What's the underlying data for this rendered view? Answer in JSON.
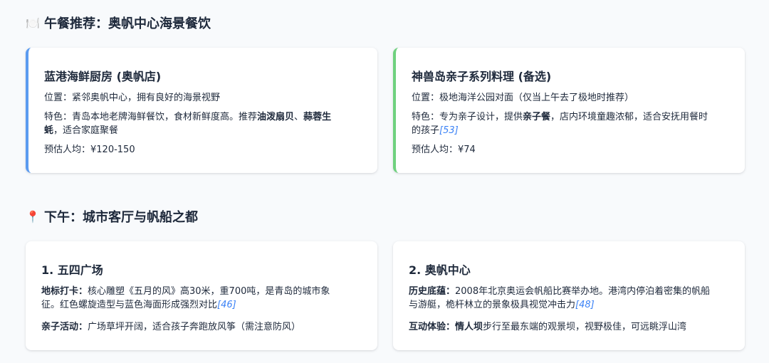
{
  "lunch": {
    "icon": "🍽️",
    "title": "午餐推荐：奥帆中心海景餐饮",
    "cards": [
      {
        "name": "蓝港海鲜厨房 (奥帆店)",
        "loc_label": "位置：",
        "loc": "紧邻奥帆中心，拥有良好的海景视野",
        "feat_label": "特色：",
        "feat_a": "青岛本地老牌海鲜餐饮，食材新鲜度高。推荐",
        "feat_b1": "油泼扇贝",
        "feat_sep": "、",
        "feat_b2": "蒜蓉生",
        "feat_b3": "蚝",
        "feat_c": "，适合家庭聚餐",
        "price_label": "预估人均：",
        "price": "¥120-150",
        "accent": "#5b9bf0"
      },
      {
        "name": "神兽岛亲子系列料理 (备选)",
        "loc_label": "位置：",
        "loc": "极地海洋公园对面（仅当上午去了极地时推荐）",
        "feat_label": "特色：",
        "feat_a": "专为亲子设计，提供",
        "feat_b": "亲子餐",
        "feat_c": "，店内环境童趣浓郁，适合安抚用餐时",
        "feat_d": "的孩子",
        "cite": "[53]",
        "price_label": "预估人均：",
        "price": "¥74",
        "accent": "#6fd17e"
      }
    ]
  },
  "afternoon": {
    "icon": "📍",
    "title": "下午：城市客厅与帆船之都",
    "cards": [
      {
        "name": "1. 五四广场",
        "l1_label": "地标打卡：",
        "l1_a": "核心雕塑《五月的风》高30米，重700吨，是青岛的城市象",
        "l1_b": "征。红色螺旋造型与蓝色海面形成强烈对比",
        "l1_cite": "[46]",
        "l2_label": "亲子活动：",
        "l2": "广场草坪开阔，适合孩子奔跑放风筝（需注意防风）"
      },
      {
        "name": "2. 奥帆中心",
        "l1_label": "历史底蕴：",
        "l1_a": "2008年北京奥运会帆船比赛举办地。港湾内停泊着密集的帆船",
        "l1_b": "与游艇，桅杆林立的景象极具视觉冲击力",
        "l1_cite": "[48]",
        "l2_label": "互动体验：",
        "l2_b": "情人坝",
        "l2": "步行至最东端的观景坝，视野极佳，可远眺浮山湾"
      }
    ]
  }
}
